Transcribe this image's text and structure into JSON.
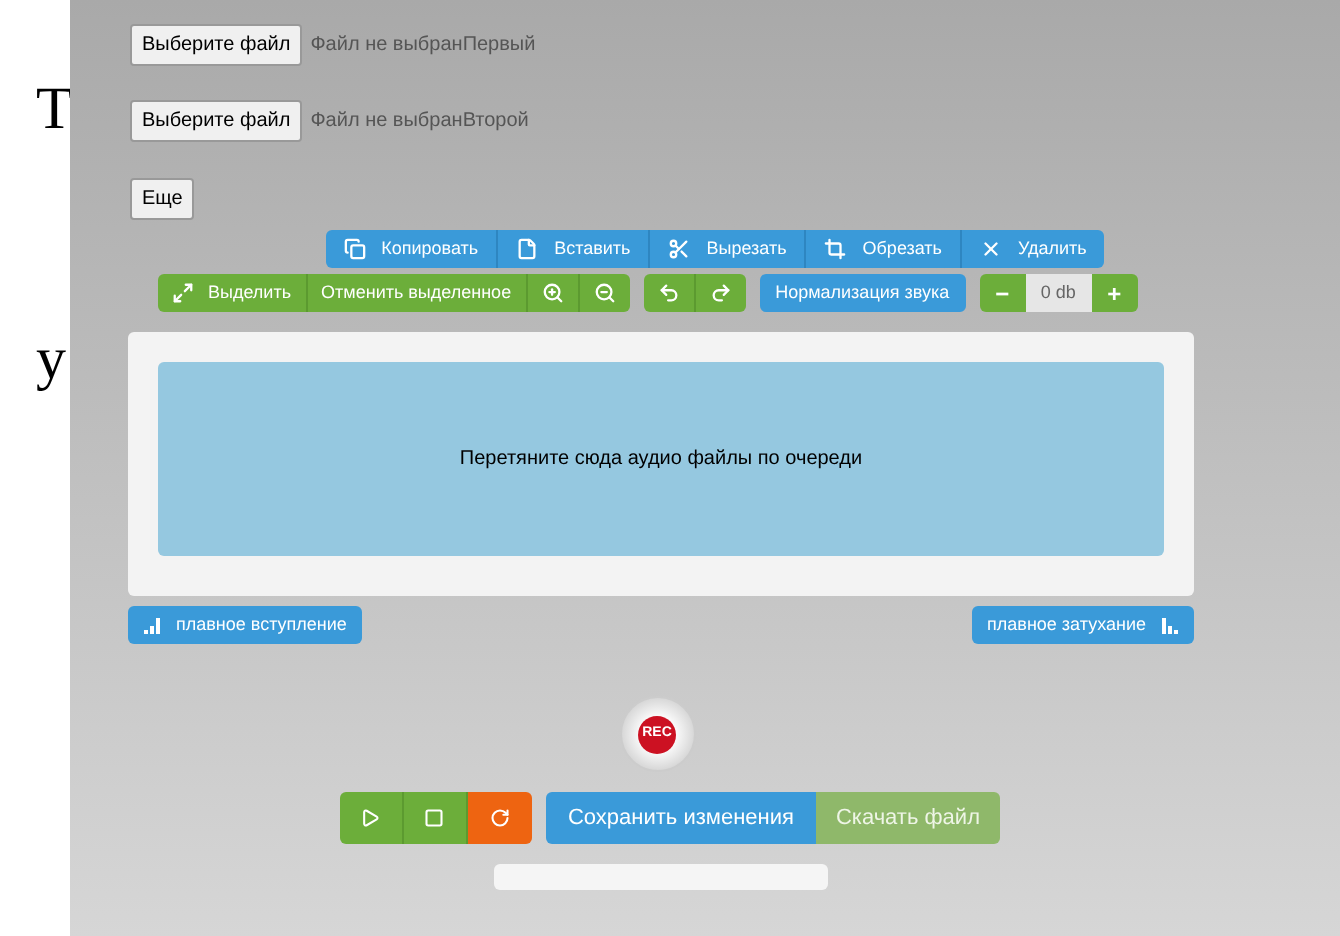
{
  "left_margin": {
    "fragments": [
      "Т",
      "у"
    ]
  },
  "file_inputs": [
    {
      "button": "Выберите файл",
      "status": "Файл не выбран",
      "label": "Первый"
    },
    {
      "button": "Выберите файл",
      "status": "Файл не выбран",
      "label": "Второй"
    }
  ],
  "more_button": "Еще",
  "edit_toolbar": [
    {
      "kind": "copy",
      "label": "Копировать"
    },
    {
      "kind": "paste",
      "label": "Вставить"
    },
    {
      "kind": "cut",
      "label": "Вырезать"
    },
    {
      "kind": "crop",
      "label": "Обрезать"
    },
    {
      "kind": "delete",
      "label": "Удалить"
    }
  ],
  "selection_toolbar": [
    {
      "kind": "select",
      "label": "Выделить"
    },
    {
      "kind": "text",
      "label": "Отменить выделенное"
    },
    {
      "kind": "zoom-in"
    },
    {
      "kind": "zoom-out"
    }
  ],
  "history_toolbar": [
    {
      "kind": "undo"
    },
    {
      "kind": "redo"
    }
  ],
  "normalize_button": "Нормализация звука",
  "gain": {
    "minus": "−",
    "value": "0 db",
    "plus": "+"
  },
  "drop_zone": {
    "text": "Перетяните сюда аудио файлы по очереди"
  },
  "fade_in_button": "плавное вступление",
  "fade_out_button": "плавное затухание",
  "rec_button": "REC",
  "transport": [
    {
      "kind": "play"
    },
    {
      "kind": "stop"
    },
    {
      "kind": "reload"
    }
  ],
  "save_button": {
    "label": "Сохранить изменения",
    "disabled": false
  },
  "download_button": {
    "label": "Скачать файл",
    "disabled": true
  }
}
